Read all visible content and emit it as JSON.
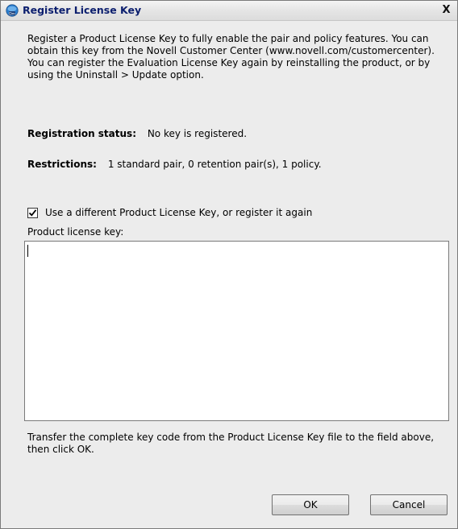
{
  "window": {
    "title": "Register License Key",
    "close_glyph": "X"
  },
  "intro_text": "Register a Product License Key to fully enable the pair and policy features. You can obtain this key from the Novell Customer Center (www.novell.com/customercenter). You can register the Evaluation License Key again by reinstalling the product, or by using the Uninstall > Update option.",
  "registration": {
    "label": "Registration status:",
    "value": "No key is registered."
  },
  "restrictions": {
    "label": "Restrictions:",
    "value": "1 standard pair, 0 retention pair(s),  1 policy."
  },
  "different_key_checkbox": {
    "checked": true,
    "label": "Use a different Product License Key, or register it again"
  },
  "license_key_field": {
    "label": "Product license key:",
    "value": ""
  },
  "hint_text": "Transfer the complete key code from the Product License Key file to the field above, then click OK.",
  "buttons": {
    "ok_label": "OK",
    "cancel_label": "Cancel"
  },
  "icons": {
    "app": "app-logo-icon",
    "close": "close-icon",
    "check": "check-icon"
  },
  "colors": {
    "title_text": "#0b1e6e",
    "dialog_background": "#ececec",
    "field_background": "#ffffff"
  }
}
